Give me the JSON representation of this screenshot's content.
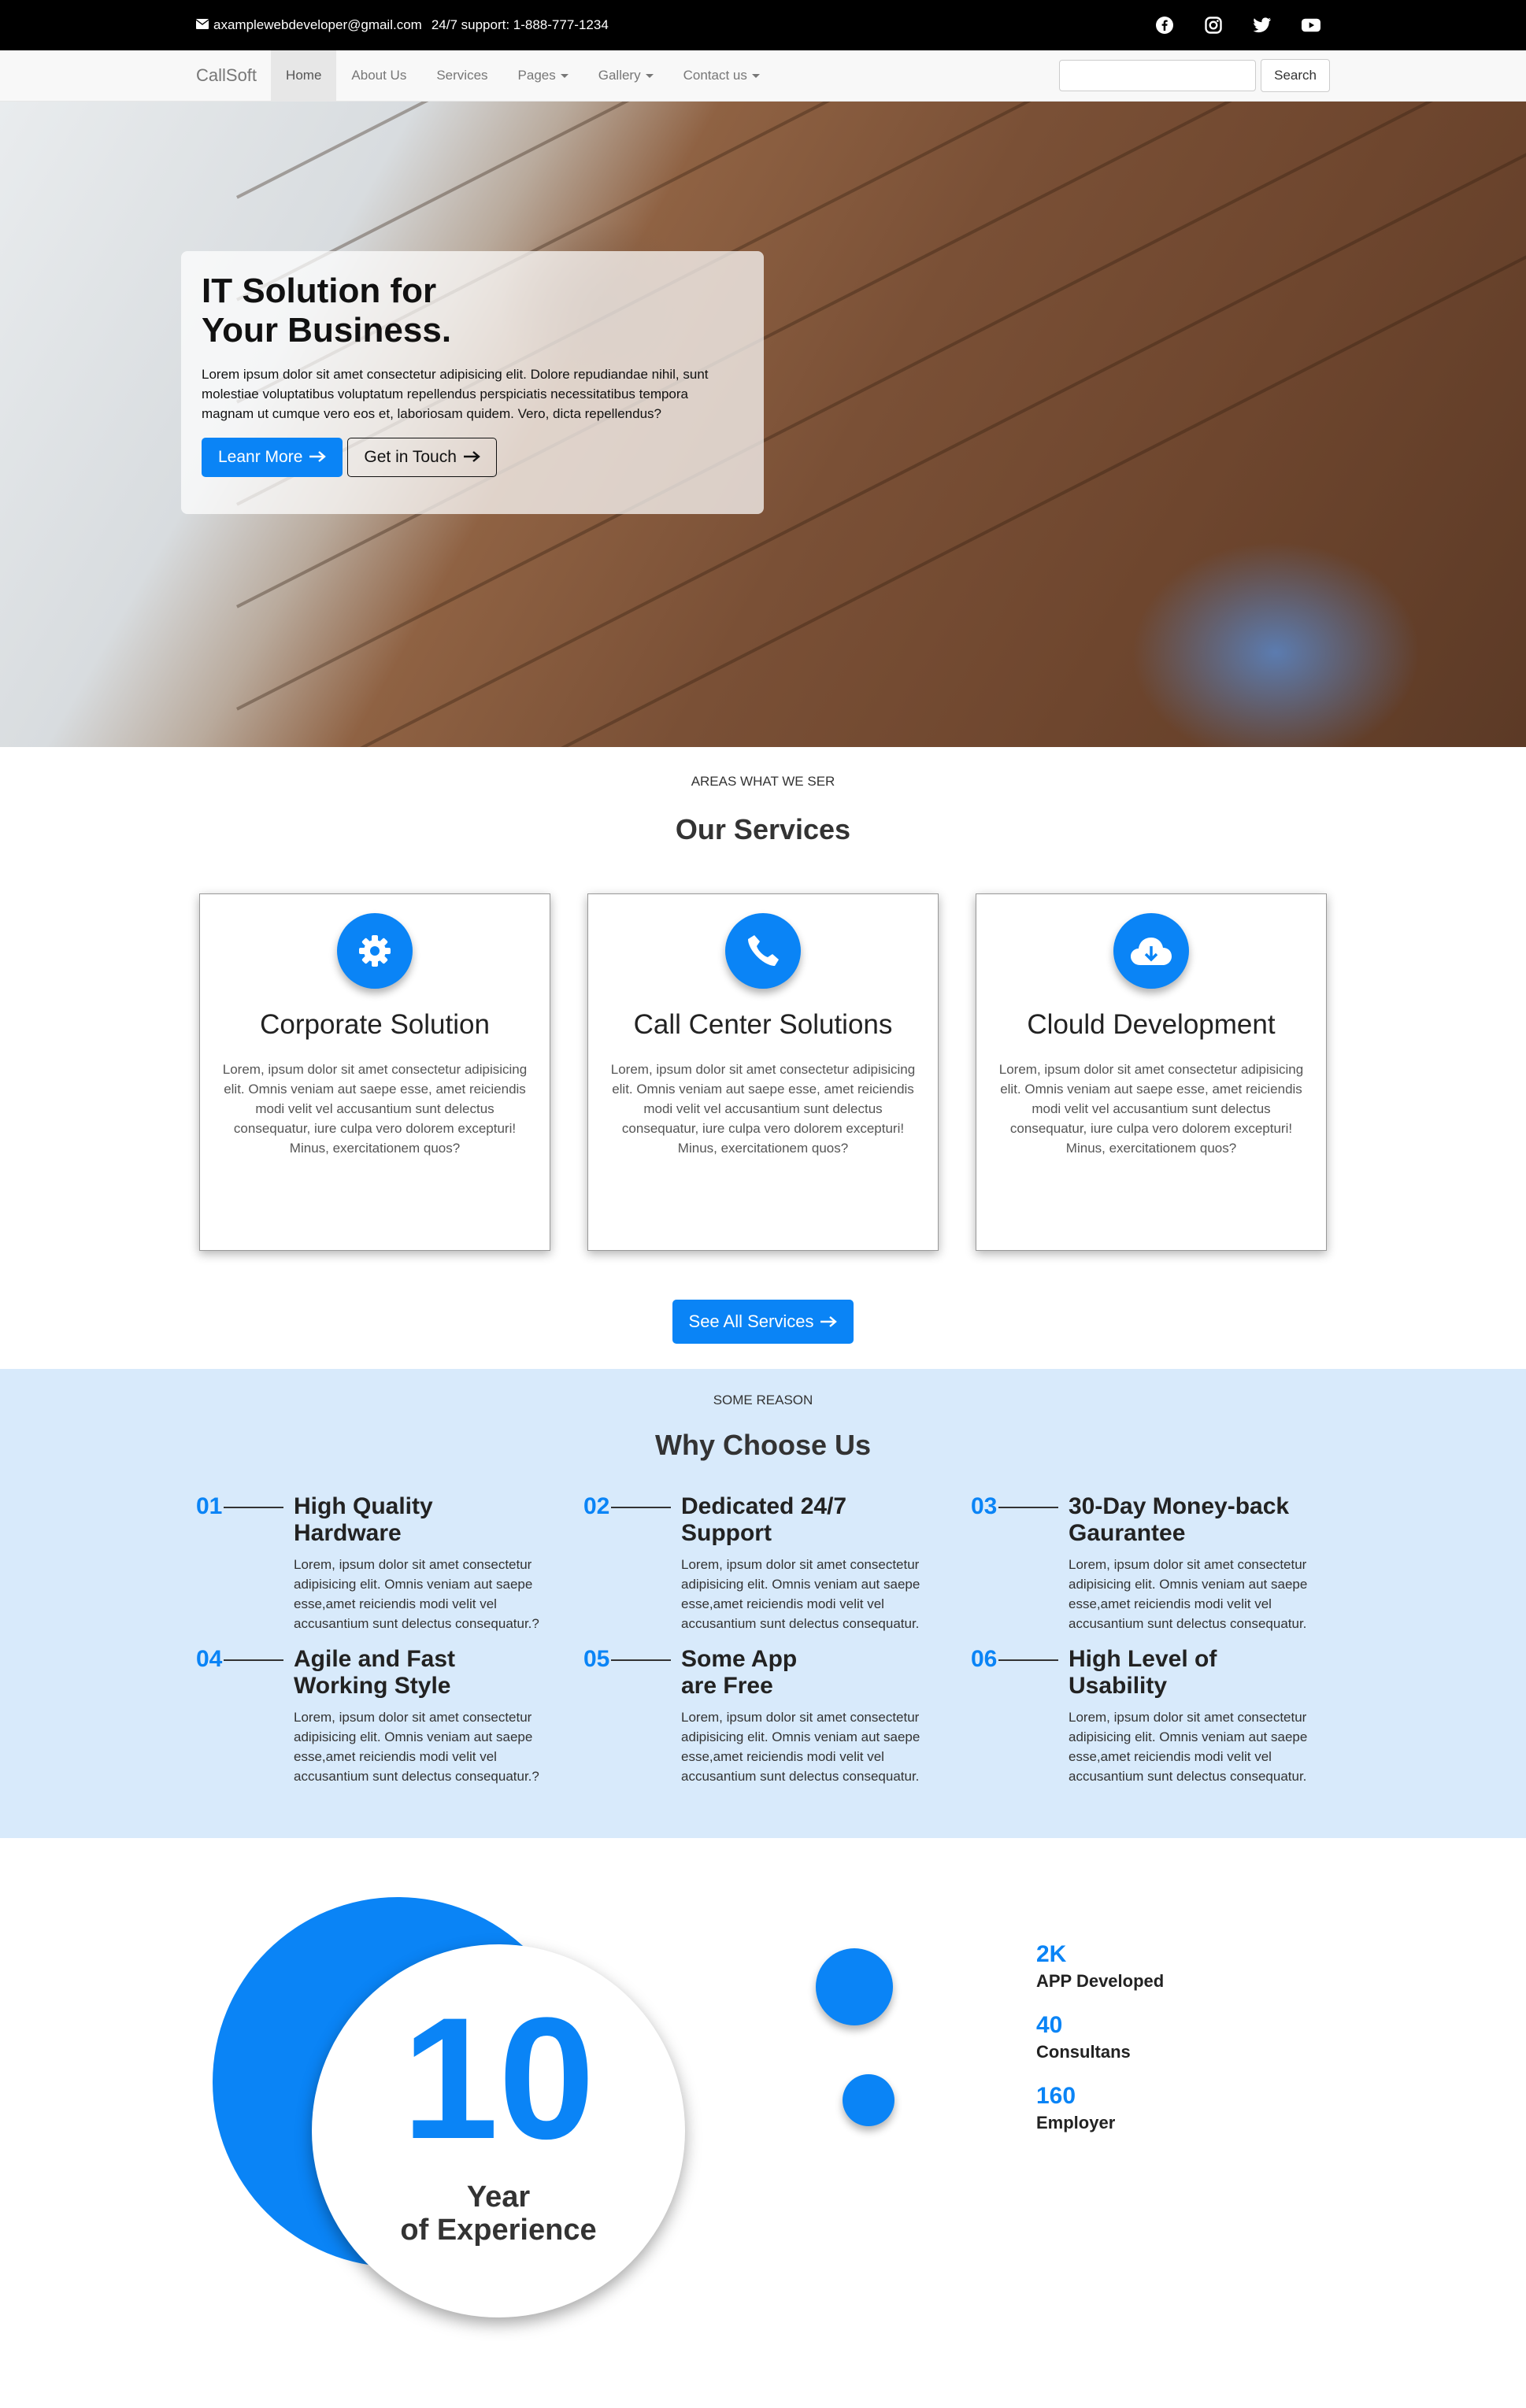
{
  "topbar": {
    "email": "axamplewebdeveloper@gmail.com",
    "support": "24/7 support: 1-888-777-1234",
    "social": [
      "facebook-icon",
      "instagram-icon",
      "twitter-icon",
      "youtube-icon"
    ]
  },
  "navbar": {
    "brand": "CallSoft",
    "items": [
      {
        "label": "Home",
        "active": true,
        "dropdown": false
      },
      {
        "label": "About Us",
        "active": false,
        "dropdown": false
      },
      {
        "label": "Services",
        "active": false,
        "dropdown": false
      },
      {
        "label": "Pages",
        "active": false,
        "dropdown": true
      },
      {
        "label": "Gallery",
        "active": false,
        "dropdown": true
      },
      {
        "label": "Contact us",
        "active": false,
        "dropdown": true
      }
    ],
    "search_placeholder": "",
    "search_button": "Search"
  },
  "hero": {
    "title_line1": "IT Solution for",
    "title_line2": "Your Business.",
    "text": "Lorem ipsum dolor sit amet consectetur adipisicing elit. Dolore repudiandae nihil, sunt molestiae voluptatibus voluptatum repellendus perspiciatis necessitatibus tempora magnam ut cumque vero eos et, laboriosam quidem. Vero, dicta repellendus?",
    "primary_button": "Leanr More",
    "secondary_button": "Get in Touch"
  },
  "services": {
    "kicker": "AREAS WHAT WE SER",
    "title": "Our Services",
    "cards": [
      {
        "icon": "gear-icon",
        "title": "Corporate Solution",
        "text": "Lorem, ipsum dolor sit amet consectetur adipisicing elit. Omnis veniam aut saepe esse, amet reiciendis modi velit vel accusantium sunt delectus consequatur, iure culpa vero dolorem excepturi! Minus, exercitationem quos?"
      },
      {
        "icon": "phone-icon",
        "title": "Call Center Solutions",
        "text": "Lorem, ipsum dolor sit amet consectetur adipisicing elit. Omnis veniam aut saepe esse, amet reiciendis modi velit vel accusantium sunt delectus consequatur, iure culpa vero dolorem excepturi! Minus, exercitationem quos?"
      },
      {
        "icon": "cloud-download-icon",
        "title": "Clould Development",
        "text": "Lorem, ipsum dolor sit amet consectetur adipisicing elit. Omnis veniam aut saepe esse, amet reiciendis modi velit vel accusantium sunt delectus consequatur, iure culpa vero dolorem excepturi! Minus, exercitationem quos?"
      }
    ],
    "see_all_button": "See All Services"
  },
  "why": {
    "kicker": "SOME REASON",
    "title": "Why Choose Us",
    "features": [
      {
        "num": "01",
        "title1": "High Quality",
        "title2": "Hardware",
        "text": "Lorem, ipsum dolor sit amet consectetur adipisicing elit. Omnis veniam aut saepe esse,amet reiciendis modi velit vel accusantium sunt delectus consequatur.?"
      },
      {
        "num": "02",
        "title1": "Dedicated 24/7",
        "title2": "Support",
        "text": "Lorem, ipsum dolor sit amet consectetur adipisicing elit. Omnis veniam aut saepe esse,amet reiciendis modi velit vel accusantium sunt delectus consequatur."
      },
      {
        "num": "03",
        "title1": "30-Day Money-back",
        "title2": "Gaurantee",
        "text": "Lorem, ipsum dolor sit amet consectetur adipisicing elit. Omnis veniam aut saepe esse,amet reiciendis modi velit vel accusantium sunt delectus consequatur."
      },
      {
        "num": "04",
        "title1": "Agile and Fast",
        "title2": "Working Style",
        "text": "Lorem, ipsum dolor sit amet consectetur adipisicing elit. Omnis veniam aut saepe esse,amet reiciendis modi velit vel accusantium sunt delectus consequatur.?"
      },
      {
        "num": "05",
        "title1": "Some App",
        "title2": "are Free",
        "text": "Lorem, ipsum dolor sit amet consectetur adipisicing elit. Omnis veniam aut saepe esse,amet reiciendis modi velit vel accusantium sunt delectus consequatur."
      },
      {
        "num": "06",
        "title1": "High Level of",
        "title2": "Usability",
        "text": "Lorem, ipsum dolor sit amet consectetur adipisicing elit. Omnis veniam aut saepe esse,amet reiciendis modi velit vel accusantium sunt delectus consequatur."
      }
    ]
  },
  "stats": {
    "years": "10",
    "years_label1": "Year",
    "years_label2": "of Experience",
    "counts": [
      {
        "value": "2K",
        "label": "APP Developed"
      },
      {
        "value": "40",
        "label": "Consultans"
      },
      {
        "value": "160",
        "label": "Employer"
      }
    ]
  },
  "colors": {
    "accent": "#0a84f6",
    "why_bg": "#d8eafb",
    "topbar_bg": "#000000"
  }
}
